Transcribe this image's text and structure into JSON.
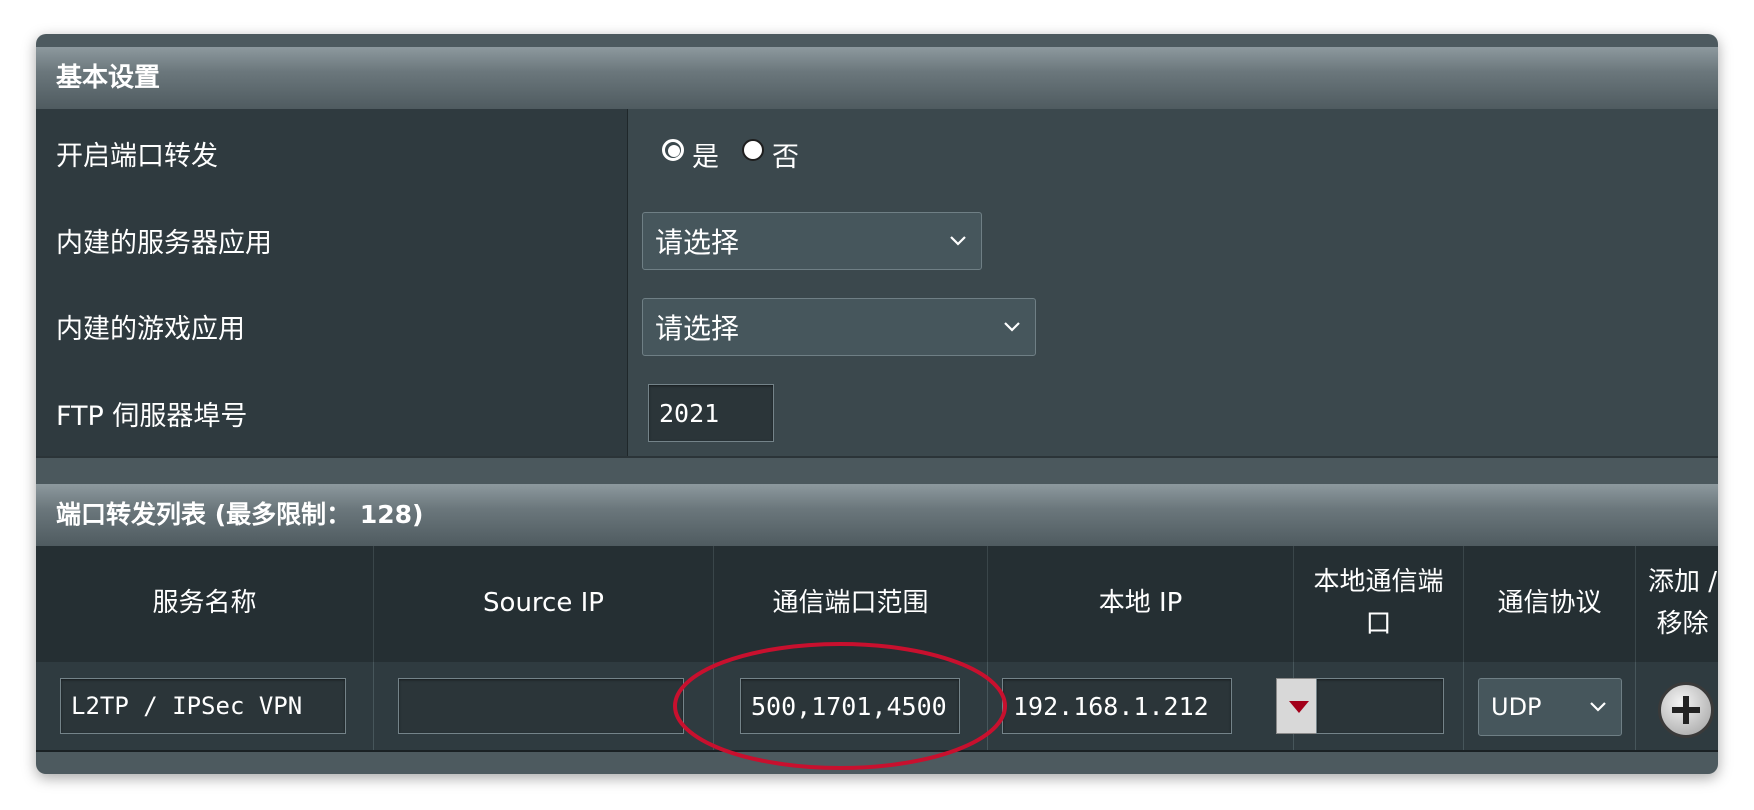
{
  "basic_settings": {
    "header": "基本设置",
    "enable_port_forwarding": {
      "label": "开启端口转发",
      "options": [
        "是",
        "否"
      ],
      "selected": "是"
    },
    "builtin_server_apps": {
      "label": "内建的服务器应用",
      "selected": "请选择"
    },
    "builtin_game_apps": {
      "label": "内建的游戏应用",
      "selected": "请选择"
    },
    "ftp_port": {
      "label": "FTP 伺服器埠号",
      "value": "2021"
    }
  },
  "forward_list": {
    "header": "端口转发列表 (最多限制： 128)",
    "columns": [
      "服务名称",
      "Source IP",
      "通信端口范围",
      "本地 IP",
      "本地通信端\n口",
      "通信协议",
      "添加 /\n移除"
    ],
    "row": {
      "service_name": "L2TP / IPSec VPN",
      "source_ip": "",
      "port_range": "500,1701,4500",
      "local_ip": "192.168.1.212",
      "local_port": "",
      "protocol": "UDP"
    }
  },
  "colors": {
    "header_bg": "#6b777c",
    "annotation_ellipse": "#c8102e"
  },
  "icons": [
    "chevron-down-icon",
    "dropdown-arrow-icon",
    "add-circle-icon"
  ]
}
